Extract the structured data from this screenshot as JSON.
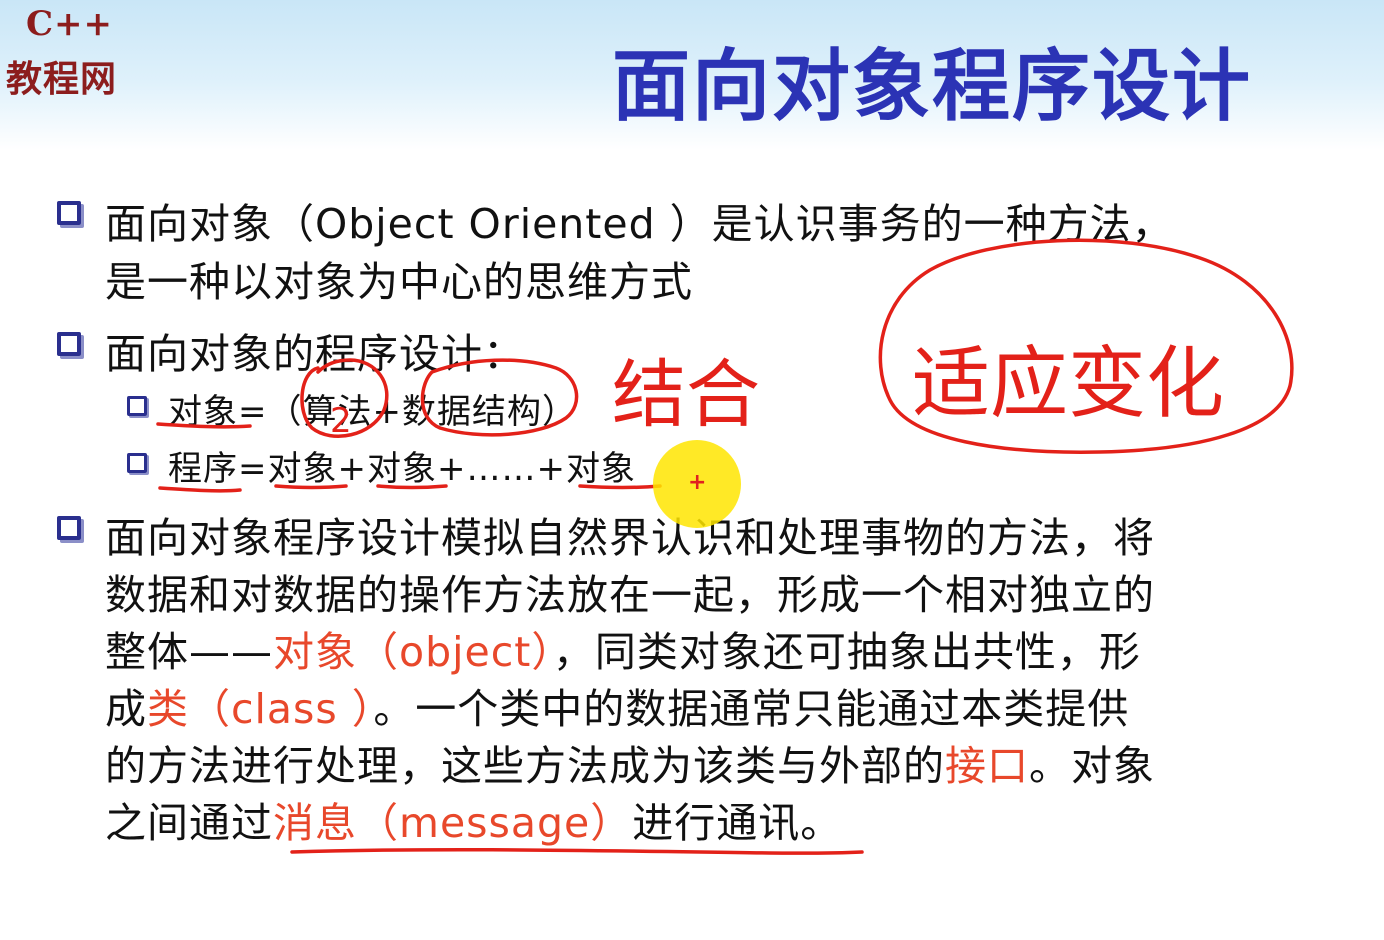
{
  "logo": {
    "top": "C++",
    "bottom": "教程网"
  },
  "title": "面向对象程序设计",
  "bullets": [
    {
      "line1": "面向对象（Object Oriented ）是认识事务的一种方法，",
      "line2": "是一种以对象为中心的思维方式"
    },
    {
      "line1": "面向对象的程序设计："
    }
  ],
  "sub_bullets": [
    "对象=（算法+数据结构）",
    "程序=对象+对象+……+对象"
  ],
  "paragraph": {
    "l1": "面向对象程序设计模拟自然界认识和处理事物的方法，将",
    "l2": "数据和对数据的操作方法放在一起，形成一个相对独立的",
    "l3a": "整体——",
    "l3b": "对象（object）",
    "l3c": "，同类对象还可抽象出共性，形",
    "l4a": "成",
    "l4b": "类（class ）",
    "l4c": "。一个类中的数据通常只能通过本类提供",
    "l5a": "的方法进行处理，这些方法成为该类与外部的",
    "l5b": "接口",
    "l5c": "。对象",
    "l6a": "之间通过",
    "l6b": "消息（message）",
    "l6c": "进行通讯。"
  },
  "annotations": {
    "combine": "结合",
    "adapt": "适应变化",
    "circle_num": "2"
  },
  "colors": {
    "title": "#2b33b5",
    "highlight": "#e8482b",
    "ink": "#e32119",
    "logo": "#8c1d1d"
  }
}
